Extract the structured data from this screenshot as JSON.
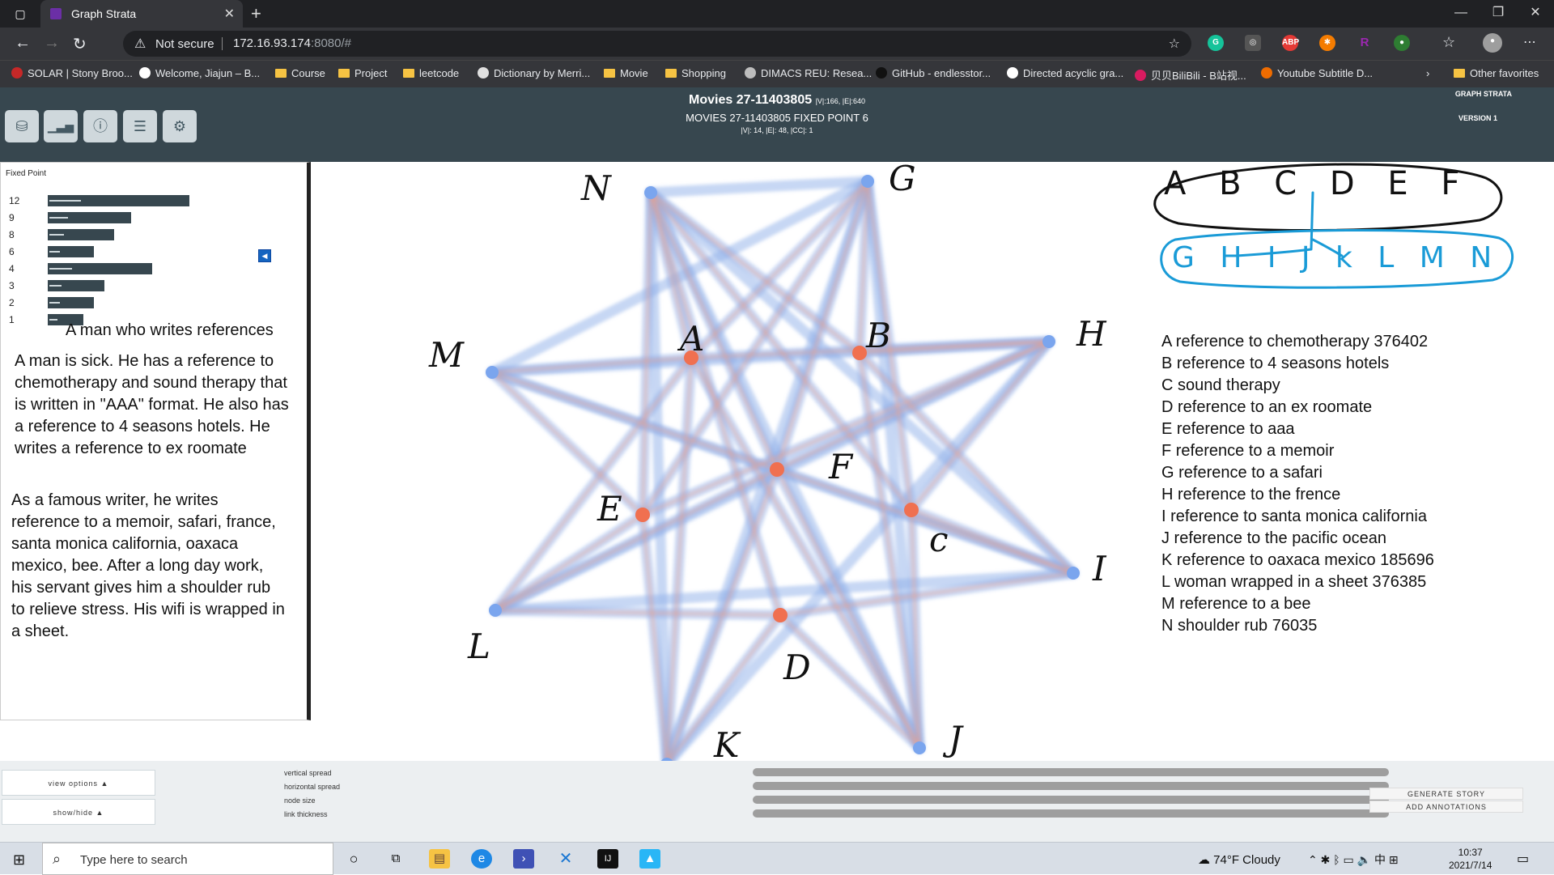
{
  "browser": {
    "tab_title": "Graph Strata",
    "not_secure": "Not secure",
    "url_host": "172.16.93.174",
    "url_rest": ":8080/#",
    "bookmarks": [
      {
        "label": "SOLAR | Stony Broo...",
        "type": "fav",
        "color": "#c62828"
      },
      {
        "label": "Welcome, Jiajun – B...",
        "type": "fav",
        "color": "#ffffff"
      },
      {
        "label": "Course",
        "type": "folder"
      },
      {
        "label": "Project",
        "type": "folder"
      },
      {
        "label": "leetcode",
        "type": "folder"
      },
      {
        "label": "Dictionary by Merri...",
        "type": "fav",
        "color": "#e0e0e0"
      },
      {
        "label": "Movie",
        "type": "folder"
      },
      {
        "label": "Shopping",
        "type": "folder"
      },
      {
        "label": "DIMACS REU: Resea...",
        "type": "fav",
        "color": "#bdbdbd"
      },
      {
        "label": "GitHub - endlesstor...",
        "type": "fav",
        "color": "#111111"
      },
      {
        "label": "Directed acyclic gra...",
        "type": "fav",
        "color": "#ffffff"
      },
      {
        "label": "贝贝BiliBili - B站视...",
        "type": "fav",
        "color": "#d81b60"
      },
      {
        "label": "Youtube Subtitle D...",
        "type": "fav",
        "color": "#ef6c00"
      }
    ],
    "other_favorites": "Other favorites"
  },
  "app_header": {
    "title": "Movies 27-11403805",
    "title_meta": "|V|:166, |E|:640",
    "subtitle": "MOVIES 27-11403805 FIXED POINT 6",
    "stats": "|V|: 14, |E|: 48, |CC|: 1",
    "brand": "GRAPH STRATA",
    "version": "VERSION 1"
  },
  "left_panel": {
    "label": "Fixed Point",
    "fixed_points": [
      {
        "num": "12",
        "value": 175
      },
      {
        "num": "9",
        "value": 103
      },
      {
        "num": "8",
        "value": 82
      },
      {
        "num": "6",
        "value": 57
      },
      {
        "num": "4",
        "value": 129
      },
      {
        "num": "3",
        "value": 70
      },
      {
        "num": "2",
        "value": 57
      },
      {
        "num": "1",
        "value": 44
      }
    ],
    "story_title": "A man who writes references",
    "paragraphs": [
      "A man is sick. He has a reference to chemotherapy and sound therapy that is written in \"AAA\" format. He also has a reference to 4 seasons hotels. He writes a reference to ex roomate",
      "As a famous writer, he writes reference to a memoir, safari, france, santa monica california, oaxaca mexico, bee. After a long day work, his servant gives him a shoulder rub to relieve stress. His wifi is wrapped in a sheet."
    ]
  },
  "graph": {
    "edge_color_outer": "#8fb0ea",
    "edge_color_inner": "#f0a088",
    "node_color_outer": "#7aa5ee",
    "node_color_inner": "#f07050",
    "nodes": [
      {
        "id": "A",
        "label": "A",
        "group": "inner"
      },
      {
        "id": "B",
        "label": "B",
        "group": "inner"
      },
      {
        "id": "C",
        "label": "c",
        "group": "inner"
      },
      {
        "id": "D",
        "label": "D",
        "group": "inner"
      },
      {
        "id": "E",
        "label": "E",
        "group": "inner"
      },
      {
        "id": "F",
        "label": "F",
        "group": "inner"
      },
      {
        "id": "G",
        "label": "G",
        "group": "outer"
      },
      {
        "id": "H",
        "label": "H",
        "group": "outer"
      },
      {
        "id": "I",
        "label": "I",
        "group": "outer"
      },
      {
        "id": "J",
        "label": "J",
        "group": "outer"
      },
      {
        "id": "K",
        "label": "K",
        "group": "outer"
      },
      {
        "id": "L",
        "label": "L",
        "group": "outer"
      },
      {
        "id": "M",
        "label": "M",
        "group": "outer"
      },
      {
        "id": "N",
        "label": "N",
        "group": "outer"
      }
    ],
    "edges": [
      [
        "N",
        "G"
      ],
      [
        "N",
        "A"
      ],
      [
        "N",
        "B"
      ],
      [
        "N",
        "F"
      ],
      [
        "N",
        "D"
      ],
      [
        "N",
        "K"
      ],
      [
        "N",
        "E"
      ],
      [
        "N",
        "C"
      ],
      [
        "G",
        "B"
      ],
      [
        "G",
        "A"
      ],
      [
        "G",
        "F"
      ],
      [
        "G",
        "C"
      ],
      [
        "G",
        "J"
      ],
      [
        "G",
        "E"
      ],
      [
        "G",
        "M"
      ],
      [
        "H",
        "B"
      ],
      [
        "H",
        "A"
      ],
      [
        "H",
        "F"
      ],
      [
        "H",
        "C"
      ],
      [
        "H",
        "E"
      ],
      [
        "H",
        "M"
      ],
      [
        "H",
        "K"
      ],
      [
        "I",
        "C"
      ],
      [
        "I",
        "B"
      ],
      [
        "I",
        "F"
      ],
      [
        "I",
        "D"
      ],
      [
        "I",
        "N"
      ],
      [
        "I",
        "L"
      ],
      [
        "J",
        "C"
      ],
      [
        "J",
        "D"
      ],
      [
        "J",
        "F"
      ],
      [
        "J",
        "B"
      ],
      [
        "J",
        "A"
      ],
      [
        "J",
        "N"
      ],
      [
        "K",
        "D"
      ],
      [
        "K",
        "E"
      ],
      [
        "K",
        "F"
      ],
      [
        "K",
        "A"
      ],
      [
        "K",
        "G"
      ],
      [
        "L",
        "E"
      ],
      [
        "L",
        "D"
      ],
      [
        "L",
        "F"
      ],
      [
        "L",
        "H"
      ],
      [
        "L",
        "A"
      ],
      [
        "M",
        "A"
      ],
      [
        "M",
        "E"
      ],
      [
        "M",
        "F"
      ],
      [
        "M",
        "I"
      ]
    ]
  },
  "annotations": {
    "row1_letters": "A B C D E F",
    "row2_letters": "G H I J k L M N",
    "row1_color": "#111111",
    "row2_color": "#1a9bd7",
    "references": [
      "A reference to chemotherapy 376402",
      "B reference to 4 seasons hotels",
      "C sound therapy",
      "D reference to an ex roomate",
      "E reference to aaa",
      "F reference to a memoir",
      "G reference to a safari",
      "H reference to the frence",
      "I reference to santa monica california",
      "J reference to the pacific ocean",
      "K reference to oaxaca mexico 185696",
      "L woman wrapped in a sheet 376385",
      "M reference to a bee",
      "N shoulder rub 76035"
    ]
  },
  "controls": {
    "view_options": "view options ▲",
    "show_hide": "show/hide ▲",
    "sliders": [
      "vertical spread",
      "horizontal spread",
      "node size",
      "link thickness"
    ],
    "generate_story": "GENERATE STORY",
    "add_annotations": "ADD ANNOTATIONS"
  },
  "taskbar": {
    "search_placeholder": "Type here to search",
    "weather": "74°F  Cloudy",
    "time": "10:37",
    "date": "2021/7/14"
  }
}
